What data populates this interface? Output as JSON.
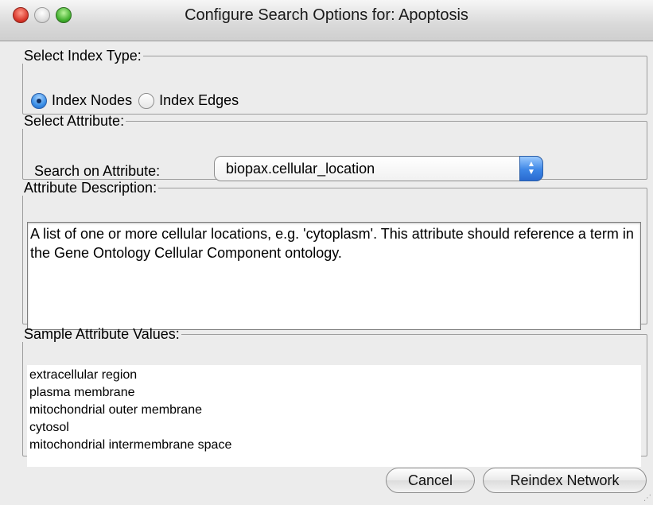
{
  "window": {
    "title": "Configure Search Options for:  Apoptosis"
  },
  "index_type": {
    "legend": "Select Index Type:",
    "options": [
      {
        "label": "Index Nodes",
        "selected": true
      },
      {
        "label": "Index Edges",
        "selected": false
      }
    ]
  },
  "attribute": {
    "legend": "Select Attribute:",
    "label": "Search on Attribute:",
    "selected_value": "biopax.cellular_location"
  },
  "description": {
    "legend": "Attribute Description:",
    "text": "A list of one or more cellular locations, e.g. 'cytoplasm'.  This attribute should reference a term in the Gene Ontology Cellular Component ontology."
  },
  "samples": {
    "legend": "Sample Attribute Values:",
    "values": [
      "extracellular region",
      "plasma membrane",
      "mitochondrial outer membrane",
      "cytosol",
      "mitochondrial intermembrane space"
    ]
  },
  "buttons": {
    "cancel": "Cancel",
    "reindex": "Reindex Network"
  },
  "colors": {
    "accent": "#3b8fe6",
    "window_bg": "#ececec"
  },
  "icons": {
    "close": "close-icon",
    "minimize": "minimize-icon",
    "zoom": "zoom-icon",
    "select_stepper": "chevron-updown-icon"
  }
}
